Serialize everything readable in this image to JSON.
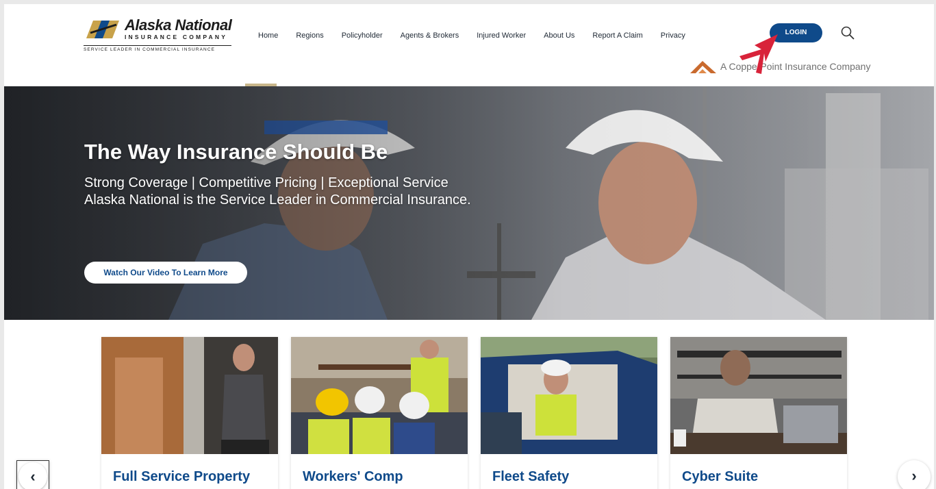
{
  "header": {
    "logo": {
      "name": "Alaska National",
      "sub": "INSURANCE COMPANY",
      "tagline": "SERVICE LEADER IN COMMERCIAL INSURANCE"
    },
    "nav": [
      "Home",
      "Regions",
      "Policyholder",
      "Agents & Brokers",
      "Injured Worker",
      "About Us",
      "Report A Claim",
      "Privacy"
    ],
    "login_label": "LOGIN",
    "copperpoint": "A CopperPoint Insurance Company"
  },
  "hero": {
    "title": "The Way Insurance Should Be",
    "subtitle_line1": "Strong Coverage | Competitive Pricing | Exceptional Service",
    "subtitle_line2": "Alaska National is the Service Leader in Commercial Insurance.",
    "video_button": "Watch Our Video To Learn More"
  },
  "cards": [
    {
      "title": "Full Service Property"
    },
    {
      "title": "Workers' Comp"
    },
    {
      "title": "Fleet Safety"
    },
    {
      "title": "Cyber Suite"
    }
  ],
  "carousel": {
    "prev_glyph": "‹",
    "next_glyph": "›"
  },
  "colors": {
    "brand_blue": "#0f4a8a",
    "accent_gold": "#c8b68a",
    "copper": "#c96a2e",
    "pointer_red": "#d8233a"
  }
}
